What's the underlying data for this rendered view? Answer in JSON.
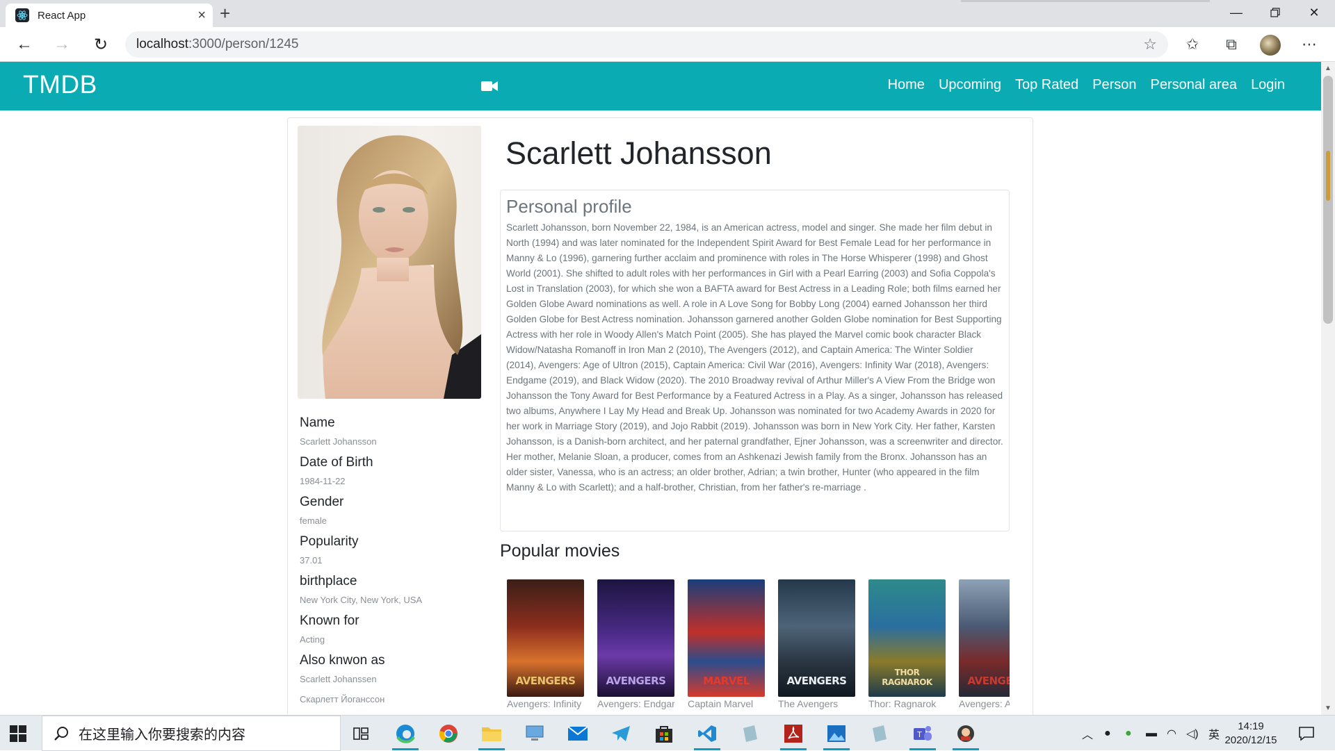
{
  "browser": {
    "tab_title": "React App",
    "url_host": "localhost",
    "url_path": ":3000/person/1245"
  },
  "site": {
    "brand": "TMDB",
    "nav": [
      "Home",
      "Upcoming",
      "Top Rated",
      "Person",
      "Personal area",
      "Login"
    ]
  },
  "person": {
    "name": "Scarlett Johansson",
    "profile_heading": "Personal profile",
    "bio": "Scarlett Johansson, born November 22, 1984, is an American actress, model and singer. She made her film debut in North (1994) and was later nominated for the Independent Spirit Award for Best Female Lead for her performance in Manny & Lo (1996), garnering further acclaim and prominence with roles in The Horse Whisperer (1998) and Ghost World (2001). She shifted to adult roles with her performances in Girl with a Pearl Earring (2003) and Sofia Coppola's Lost in Translation (2003), for which she won a BAFTA award for Best Actress in a Leading Role; both films earned her Golden Globe Award nominations as well. A role in A Love Song for Bobby Long (2004) earned Johansson her third Golden Globe for Best Actress nomination. Johansson garnered another Golden Globe nomination for Best Supporting Actress with her role in Woody Allen's Match Point (2005). She has played the Marvel comic book character Black Widow/Natasha Romanoff in Iron Man 2 (2010), The Avengers (2012), and Captain America: The Winter Soldier (2014), Avengers: Age of Ultron (2015), Captain America: Civil War (2016), Avengers: Infinity War (2018), Avengers: Endgame (2019), and Black Widow (2020). The 2010 Broadway revival of Arthur Miller's A View From the Bridge won Johansson the Tony Award for Best Performance by a Featured Actress in a Play. As a singer, Johansson has released two albums, Anywhere I Lay My Head and Break Up. Johansson was nominated for two Academy Awards in 2020 for her work in Marriage Story (2019), and Jojo Rabbit (2019). Johansson was born in New York City. Her father, Karsten Johansson, is a Danish-born architect, and her paternal grandfather, Ejner Johansson, was a screenwriter and director. Her mother, Melanie Sloan, a producer, comes from an Ashkenazi Jewish family from the Bronx. Johansson has an older sister, Vanessa, who is an actress; an older brother, Adrian; a twin brother, Hunter (who appeared in the film Manny & Lo with Scarlett); and a half-brother, Christian, from her father's re-marriage .",
    "details": [
      {
        "label": "Name",
        "value": "Scarlett Johansson"
      },
      {
        "label": "Date of Birth",
        "value": "1984-11-22"
      },
      {
        "label": "Gender",
        "value": "female"
      },
      {
        "label": "Popularity",
        "value": "37.01"
      },
      {
        "label": "birthplace",
        "value": "New York City, New York, USA"
      },
      {
        "label": "Known for",
        "value": "Acting"
      },
      {
        "label": "Also knwon as",
        "value": "Scarlett Johanssen"
      }
    ],
    "also_known_as_2": "Скарлетт Йоганссон",
    "popular_heading": "Popular movies",
    "movies": [
      {
        "title": "Avengers: Infinity War",
        "poster_text": "AVENGERS"
      },
      {
        "title": "Avengers: Endgame",
        "poster_text": "AVENGERS"
      },
      {
        "title": "Captain Marvel",
        "poster_text": "MARVEL"
      },
      {
        "title": "The Avengers",
        "poster_text": "AVENGERS"
      },
      {
        "title": "Thor: Ragnarok",
        "poster_text": "THOR RAGNAROK"
      },
      {
        "title": "Avengers: Age of Ultron",
        "poster_text": "AVENGERS"
      }
    ]
  },
  "taskbar": {
    "search_placeholder": "在这里输入你要搜索的内容",
    "ime": "英",
    "time": "14:19",
    "date": "2020/12/15"
  },
  "colors": {
    "navbar": "#0aabb2"
  }
}
